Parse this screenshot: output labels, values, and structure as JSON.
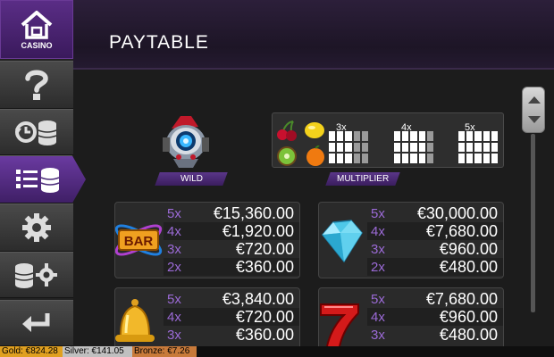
{
  "header": {
    "title": "PAYTABLE"
  },
  "sidebar": {
    "casino_label": "CASINO",
    "items": [
      {
        "name": "help",
        "icon": "question-icon"
      },
      {
        "name": "history",
        "icon": "history-coins-icon"
      },
      {
        "name": "paytable",
        "icon": "paytable-list-icon",
        "active": true
      },
      {
        "name": "settings",
        "icon": "gear-icon"
      },
      {
        "name": "coin-settings",
        "icon": "coins-gear-icon"
      },
      {
        "name": "back",
        "icon": "back-arrow-icon"
      }
    ]
  },
  "wild": {
    "label": "WILD"
  },
  "multiplier": {
    "label": "MULTIPLIER",
    "levels": [
      "3x",
      "4x",
      "5x"
    ]
  },
  "paytable": [
    {
      "symbol": "bar",
      "rows": [
        {
          "mult": "5x",
          "value": "€15,360.00"
        },
        {
          "mult": "4x",
          "value": "€1,920.00"
        },
        {
          "mult": "3x",
          "value": "€720.00"
        },
        {
          "mult": "2x",
          "value": "€360.00"
        }
      ]
    },
    {
      "symbol": "diamond",
      "rows": [
        {
          "mult": "5x",
          "value": "€30,000.00"
        },
        {
          "mult": "4x",
          "value": "€7,680.00"
        },
        {
          "mult": "3x",
          "value": "€960.00"
        },
        {
          "mult": "2x",
          "value": "€480.00"
        }
      ]
    },
    {
      "symbol": "bell",
      "rows": [
        {
          "mult": "5x",
          "value": "€3,840.00"
        },
        {
          "mult": "4x",
          "value": "€720.00"
        },
        {
          "mult": "3x",
          "value": "€360.00"
        }
      ]
    },
    {
      "symbol": "seven",
      "rows": [
        {
          "mult": "5x",
          "value": "€7,680.00"
        },
        {
          "mult": "4x",
          "value": "€960.00"
        },
        {
          "mult": "3x",
          "value": "€480.00"
        }
      ]
    }
  ],
  "jackpots": {
    "gold": "Gold: €824.28",
    "silver": "Silver: €141.05",
    "bronze": "Bronze: €7.26"
  },
  "colors": {
    "accent": "#5a2d86",
    "multiplier_text": "#9b6ad6",
    "gold": "#e0a020",
    "silver": "#c0c0c0",
    "bronze": "#c87a3a"
  }
}
